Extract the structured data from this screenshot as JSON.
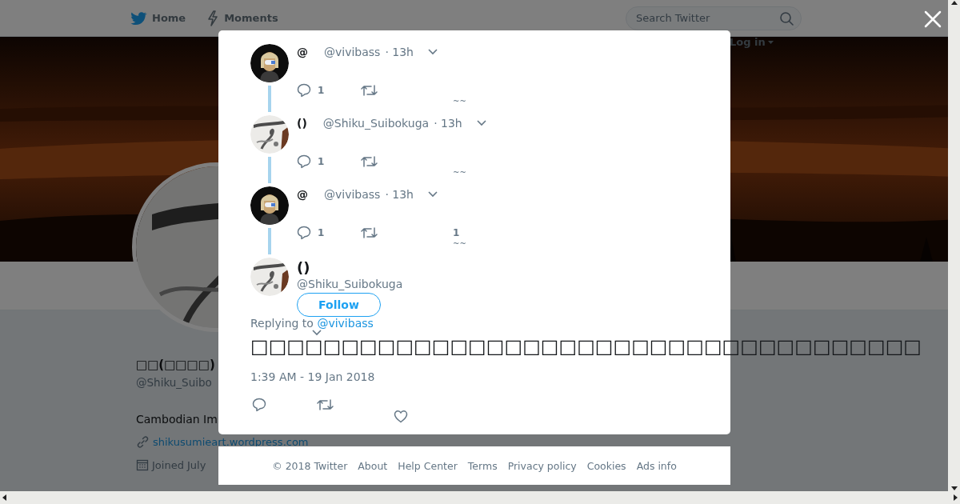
{
  "page": {
    "nav": [
      {
        "kind": "home",
        "label": "Home"
      },
      {
        "kind": "moments",
        "label": "Moments"
      }
    ],
    "search": {
      "placeholder": "Search Twitter"
    },
    "login": "Log in",
    "profile": {
      "name": "□□(□□□□)",
      "handle": "@Shiku_Suibo",
      "bio": "Cambodian Im",
      "link": "shikusumieart.wordpress.com",
      "joined": "Joined July"
    }
  },
  "dialog": {
    "thread": [
      {
        "name": "@",
        "handle": "@vivibass",
        "time": "· 13h",
        "replies": "1",
        "like_mark": "~~"
      },
      {
        "name": "()",
        "handle": "@Shiku_Suibokuga",
        "time": "· 13h",
        "replies": "1",
        "like_mark": "~~"
      },
      {
        "name": "@",
        "handle": "@vivibass",
        "time": "· 13h",
        "replies": "1",
        "likes": "1",
        "like_mark": "~~"
      }
    ],
    "main": {
      "name": "()",
      "handle": "@Shiku_Suibokuga",
      "follow": "Follow",
      "replying_label": "Replying to",
      "replying_to": "@vivibass",
      "text": "□□□□□□□□□□□□□□□□□□□□□□□□□□□□□□□□□□□□□",
      "time": "1:39 AM - 19 Jan 2018"
    },
    "footer": [
      "© 2018 Twitter",
      "About",
      "Help Center",
      "Terms",
      "Privacy policy",
      "Cookies",
      "Ads info"
    ]
  }
}
